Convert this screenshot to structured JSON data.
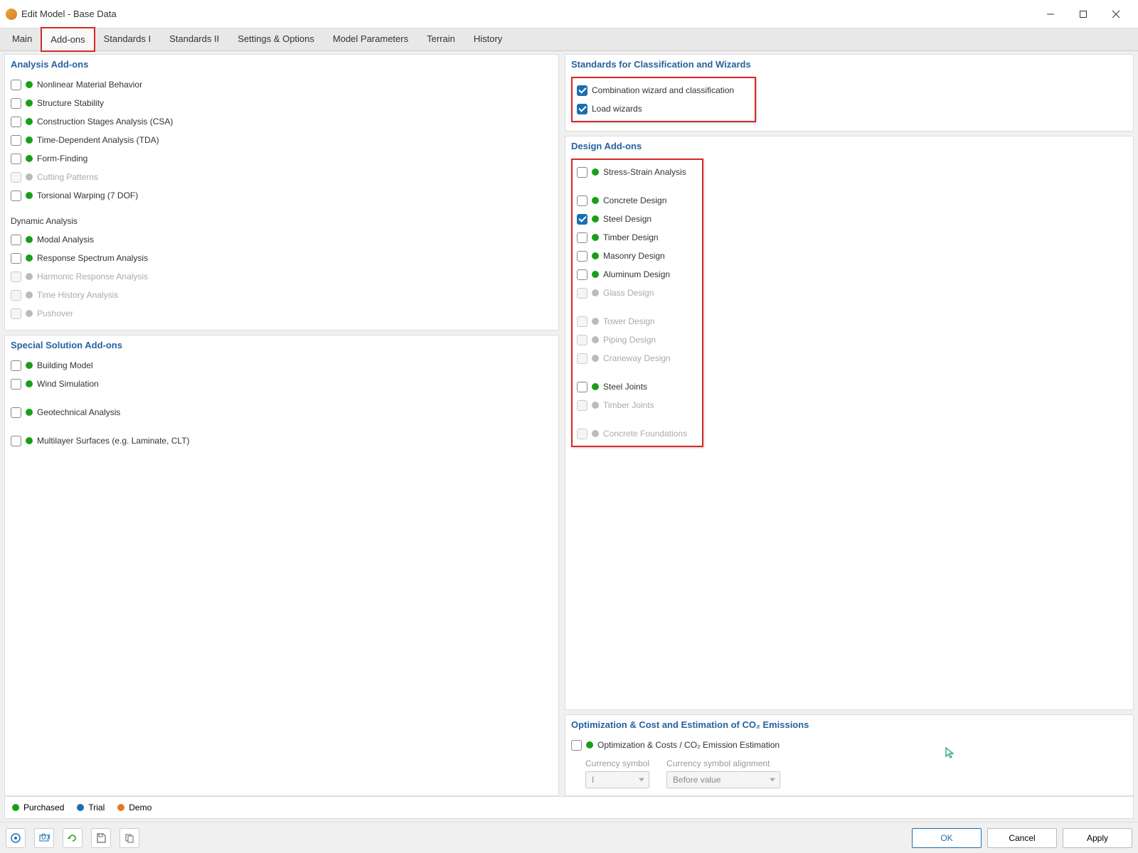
{
  "window": {
    "title": "Edit Model - Base Data"
  },
  "tabs": [
    {
      "label": "Main"
    },
    {
      "label": "Add-ons"
    },
    {
      "label": "Standards I"
    },
    {
      "label": "Standards II"
    },
    {
      "label": "Settings & Options"
    },
    {
      "label": "Model Parameters"
    },
    {
      "label": "Terrain"
    },
    {
      "label": "History"
    }
  ],
  "analysis": {
    "title": "Analysis Add-ons",
    "items": [
      {
        "label": "Nonlinear Material Behavior",
        "status": "green"
      },
      {
        "label": "Structure Stability",
        "status": "green"
      },
      {
        "label": "Construction Stages Analysis (CSA)",
        "status": "green"
      },
      {
        "label": "Time-Dependent Analysis (TDA)",
        "status": "green"
      },
      {
        "label": "Form-Finding",
        "status": "green"
      },
      {
        "label": "Cutting Patterns",
        "status": "grey",
        "disabled": true
      },
      {
        "label": "Torsional Warping (7 DOF)",
        "status": "green"
      }
    ],
    "dynamic_title": "Dynamic Analysis",
    "dynamic_items": [
      {
        "label": "Modal Analysis",
        "status": "green"
      },
      {
        "label": "Response Spectrum Analysis",
        "status": "green"
      },
      {
        "label": "Harmonic Response Analysis",
        "status": "grey",
        "disabled": true
      },
      {
        "label": "Time History Analysis",
        "status": "grey",
        "disabled": true
      },
      {
        "label": "Pushover",
        "status": "grey",
        "disabled": true
      }
    ]
  },
  "special": {
    "title": "Special Solution Add-ons",
    "items": [
      {
        "label": "Building Model",
        "status": "green"
      },
      {
        "label": "Wind Simulation",
        "status": "green"
      },
      {
        "label": "Geotechnical Analysis",
        "status": "green",
        "gap": true
      },
      {
        "label": "Multilayer Surfaces (e.g. Laminate, CLT)",
        "status": "green",
        "gap": true
      }
    ]
  },
  "standards": {
    "title": "Standards for Classification and Wizards",
    "items": [
      {
        "label": "Combination wizard and classification",
        "checked": true
      },
      {
        "label": "Load wizards",
        "checked": true
      }
    ]
  },
  "design": {
    "title": "Design Add-ons",
    "groups": [
      [
        {
          "label": "Stress-Strain Analysis",
          "status": "green"
        }
      ],
      [
        {
          "label": "Concrete Design",
          "status": "green"
        },
        {
          "label": "Steel Design",
          "status": "green",
          "checked": true
        },
        {
          "label": "Timber Design",
          "status": "green"
        },
        {
          "label": "Masonry Design",
          "status": "green"
        },
        {
          "label": "Aluminum Design",
          "status": "green"
        },
        {
          "label": "Glass Design",
          "status": "grey",
          "disabled": true
        }
      ],
      [
        {
          "label": "Tower Design",
          "status": "grey",
          "disabled": true
        },
        {
          "label": "Piping Design",
          "status": "grey",
          "disabled": true
        },
        {
          "label": "Craneway Design",
          "status": "grey",
          "disabled": true
        }
      ],
      [
        {
          "label": "Steel Joints",
          "status": "green"
        },
        {
          "label": "Timber Joints",
          "status": "grey",
          "disabled": true
        }
      ],
      [
        {
          "label": "Concrete Foundations",
          "status": "grey",
          "disabled": true
        }
      ]
    ]
  },
  "optimization": {
    "title": "Optimization & Cost and Estimation of CO₂ Emissions",
    "item": {
      "label": "Optimization & Costs / CO₂ Emission Estimation",
      "status": "green"
    },
    "currency_symbol_label": "Currency symbol",
    "currency_symbol_value": "I",
    "currency_align_label": "Currency symbol alignment",
    "currency_align_value": "Before value"
  },
  "legend": {
    "purchased": "Purchased",
    "trial": "Trial",
    "demo": "Demo"
  },
  "buttons": {
    "ok": "OK",
    "cancel": "Cancel",
    "apply": "Apply"
  }
}
